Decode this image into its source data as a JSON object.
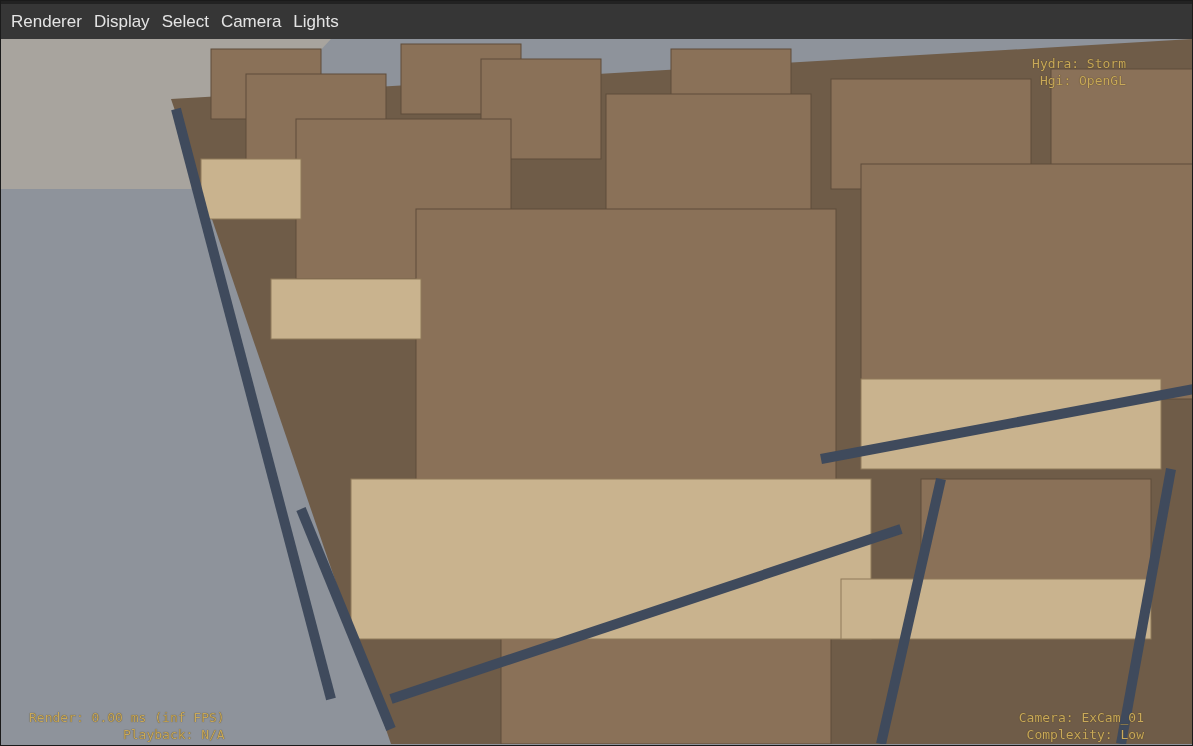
{
  "menu_bar": {
    "items": [
      "Renderer",
      "Display",
      "Select",
      "Camera",
      "Lights"
    ]
  },
  "viewport": {
    "hud_top_right": [
      "Hydra: Storm",
      "Hgi: OpenGL"
    ],
    "hud_bottom_left": [
      "Render: 0.00 ms (inf FPS)",
      "Playback: N/A"
    ],
    "hud_bottom_right": [
      "Camera: ExCam_01",
      "Complexity: Low"
    ]
  }
}
